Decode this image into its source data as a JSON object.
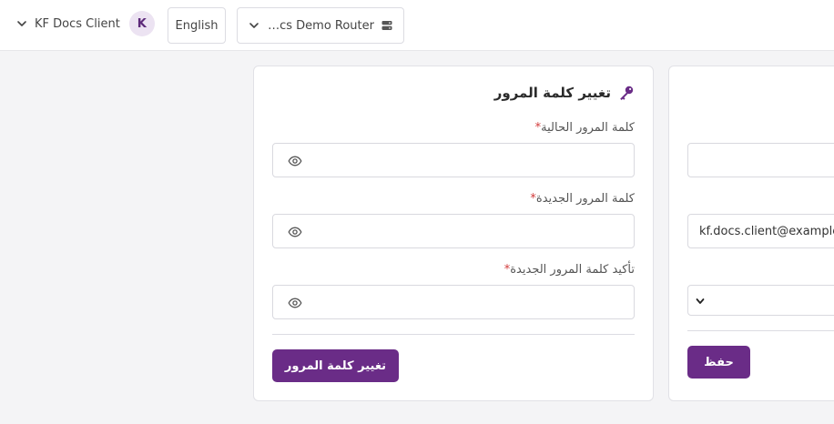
{
  "header": {
    "user_name": "KF Docs Client",
    "avatar_initial": "K",
    "language_label": "English",
    "router_label": "KF Docs Demo Router"
  },
  "password_card": {
    "title": "تغيير كلمة المرور",
    "current_password_label": "كلمة المرور الحالية",
    "new_password_label": "كلمة المرور الجديدة",
    "confirm_password_label": "تأكيد كلمة المرور الجديدة",
    "required_mark": "*",
    "current_password_value": "",
    "new_password_value": "",
    "confirm_password_value": "",
    "submit_label": "تغيير كلمة المرور"
  },
  "profile_card": {
    "name_value": "",
    "email_value": "kf.docs.client@example.test",
    "select_value": "",
    "save_label": "حفظ"
  },
  "colors": {
    "primary": "#6a2c87",
    "required": "#d23b3b",
    "avatar_bg": "#ece3f2"
  },
  "icons": {
    "user_menu": "chevron-down-icon",
    "router": "server-icon",
    "title": "key-icon",
    "password_visibility": "eye-icon"
  }
}
